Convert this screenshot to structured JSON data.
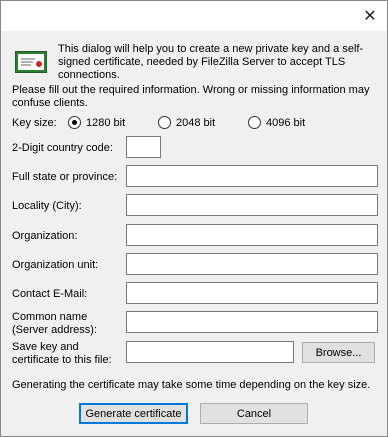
{
  "window": {
    "close_glyph": "✕"
  },
  "intro": "This dialog will help you to create a new private key and a self-signed certificate, needed by FileZilla Server to accept TLS connections.",
  "info": "Please fill out the required information. Wrong or missing information may confuse clients.",
  "key_size": {
    "label": "Key size:",
    "options": [
      "1280 bit",
      "2048 bit",
      "4096 bit"
    ],
    "selected": "1280 bit"
  },
  "fields": {
    "country": {
      "label": "2-Digit country code:",
      "value": ""
    },
    "state": {
      "label": "Full state or province:",
      "value": ""
    },
    "locality": {
      "label": "Locality (City):",
      "value": ""
    },
    "organization": {
      "label": "Organization:",
      "value": ""
    },
    "org_unit": {
      "label": "Organization unit:",
      "value": ""
    },
    "email": {
      "label": "Contact E-Mail:",
      "value": ""
    },
    "common_name": {
      "label_line1": "Common name",
      "label_line2": "(Server address):",
      "value": ""
    },
    "save_path": {
      "label_line1": "Save key and",
      "label_line2": "certificate to this file:",
      "value": ""
    }
  },
  "buttons": {
    "browse": "Browse...",
    "generate": "Generate certificate",
    "cancel": "Cancel"
  },
  "note": "Generating the certificate may take some time depending on the key size."
}
